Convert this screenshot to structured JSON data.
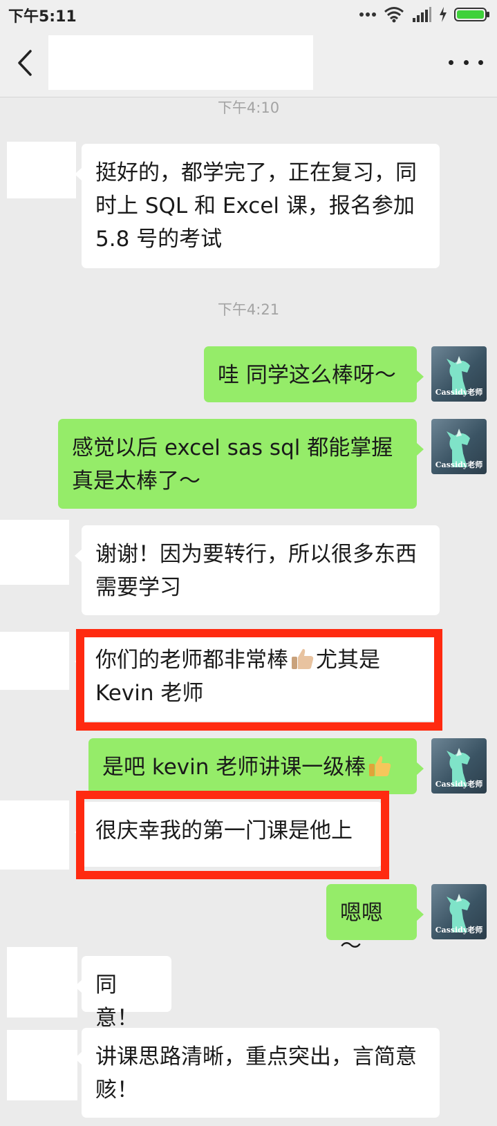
{
  "status_bar": {
    "time": "下午5:11"
  },
  "nav": {
    "title": ""
  },
  "avatar_me_label": "Cassidy老师",
  "timestamps": [
    "下午4:10",
    "下午4:21"
  ],
  "messages": {
    "m1": {
      "sender": "other",
      "text": "挺好的，都学完了，正在复习，同时上 SQL 和 Excel 课，报名参加 5.8 号的考试"
    },
    "m2": {
      "sender": "me",
      "text": "哇 同学这么棒呀～"
    },
    "m3": {
      "sender": "me",
      "text": "感觉以后 excel sas sql 都能掌握真是太棒了～"
    },
    "m4": {
      "sender": "other",
      "text": "谢谢！因为要转行，所以很多东西需要学习"
    },
    "m5": {
      "sender": "other",
      "text_a": "你们的老师都非常棒",
      "emoji": "thumbs-up",
      "text_b": "尤其是 Kevin 老师"
    },
    "m6": {
      "sender": "me",
      "text": "是吧 kevin 老师讲课一级棒",
      "emoji": "thumbs-up"
    },
    "m7": {
      "sender": "other",
      "text": "很庆幸我的第一门课是他上"
    },
    "m8": {
      "sender": "me",
      "text": "嗯嗯～"
    },
    "m9": {
      "sender": "other",
      "text": "同意！"
    },
    "m10": {
      "sender": "other",
      "text": "讲课思路清晰，重点突出，言简意赅！"
    }
  },
  "colors": {
    "background": "#ebebeb",
    "bubble_me": "#95ec69",
    "bubble_other": "#ffffff",
    "highlight": "#ff2a10",
    "timestamp": "#a3a3a3"
  },
  "icons": [
    "back-arrow-icon",
    "more-icon",
    "wifi-icon",
    "signal-icon",
    "battery-icon",
    "thumbs-up-icon"
  ]
}
